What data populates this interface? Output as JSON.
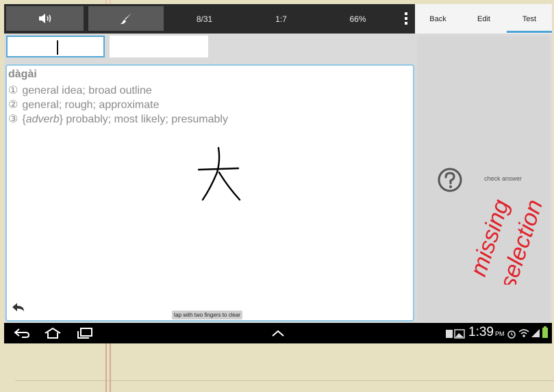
{
  "toolbar": {
    "speaker_icon": "speaker-icon",
    "brush_icon": "brush-icon",
    "progress_text": "8/31",
    "ratio_text": "1:7",
    "percent_text": "66%"
  },
  "tabs": [
    {
      "label": "Back"
    },
    {
      "label": "Edit"
    },
    {
      "label": "Test"
    }
  ],
  "entry": {
    "pinyin": "dàgài",
    "definitions": [
      {
        "num": "①",
        "text": "general idea; broad outline"
      },
      {
        "num": "②",
        "text": "general; rough; approximate"
      },
      {
        "num": "③",
        "pre": "{",
        "italic": "adverb",
        "post": "} probably; most likely; presumably"
      }
    ]
  },
  "canvas": {
    "clear_hint": "tap with two fingers to clear",
    "handwriting": "大"
  },
  "answer_panel": {
    "check_label": "check answer",
    "annotation": [
      "missing",
      "selection"
    ]
  },
  "status_bar": {
    "time": "1:39",
    "ampm": "PM"
  },
  "colors": {
    "accent": "#4aa5d6",
    "annotation": "#e0222a"
  }
}
